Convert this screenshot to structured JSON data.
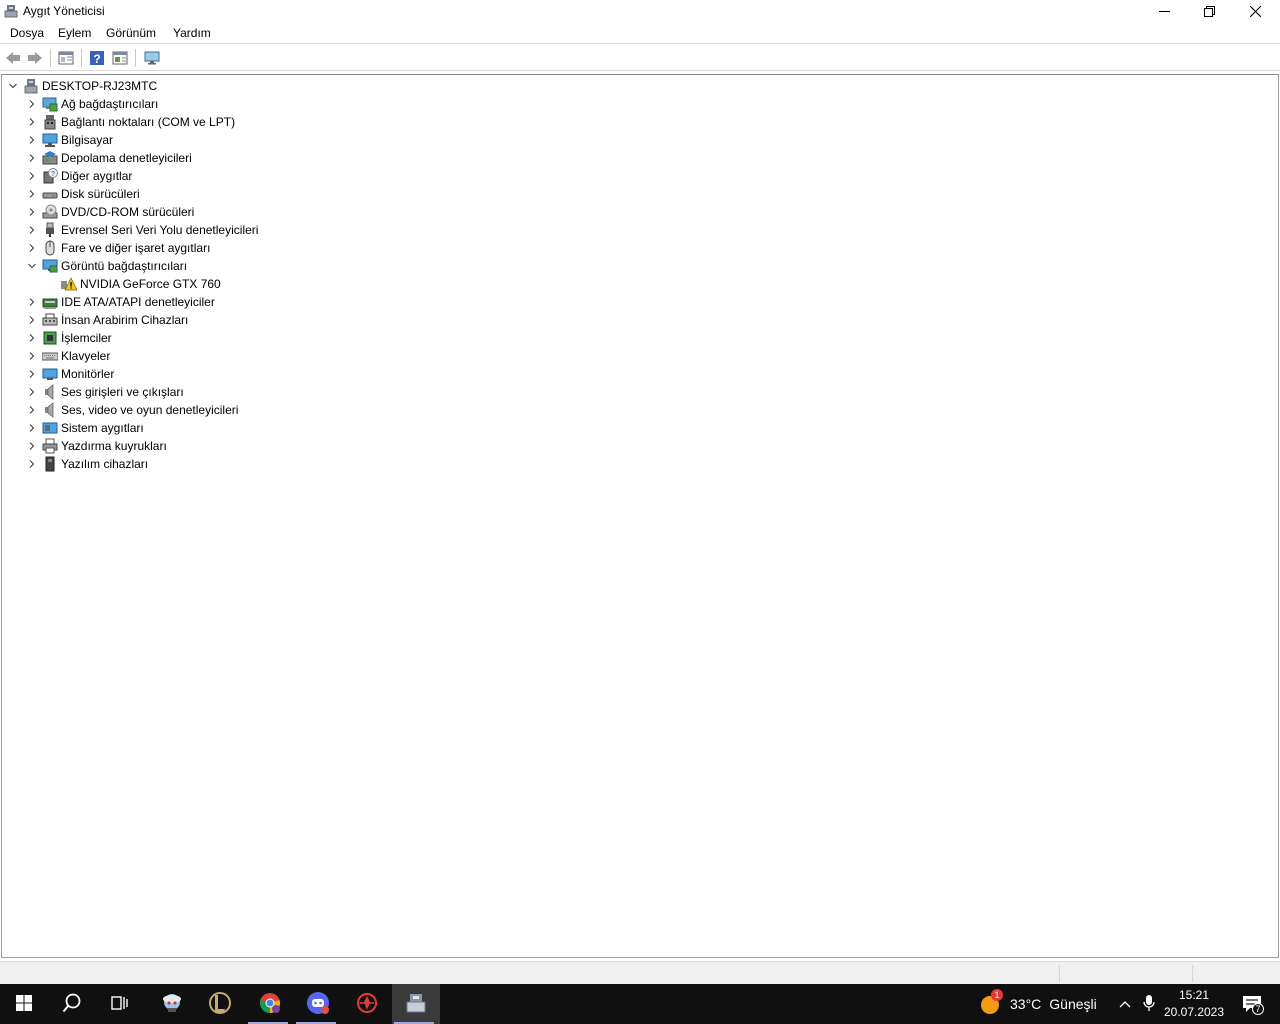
{
  "window": {
    "title": "Aygıt Yöneticisi"
  },
  "menu": [
    "Dosya",
    "Eylem",
    "Görünüm",
    "Yardım"
  ],
  "tree": {
    "root": "DESKTOP-RJ23MTC",
    "categories": [
      {
        "label": "Ağ bağdaştırıcıları",
        "icon": "network-adapter-icon",
        "expanded": false
      },
      {
        "label": "Bağlantı noktaları (COM ve LPT)",
        "icon": "port-icon",
        "expanded": false
      },
      {
        "label": "Bilgisayar",
        "icon": "computer-icon",
        "expanded": false
      },
      {
        "label": "Depolama denetleyicileri",
        "icon": "storage-controller-icon",
        "expanded": false
      },
      {
        "label": "Diğer aygıtlar",
        "icon": "other-devices-icon",
        "expanded": false
      },
      {
        "label": "Disk sürücüleri",
        "icon": "disk-drive-icon",
        "expanded": false
      },
      {
        "label": "DVD/CD-ROM sürücüleri",
        "icon": "dvd-drive-icon",
        "expanded": false
      },
      {
        "label": "Evrensel Seri Veri Yolu denetleyicileri",
        "icon": "usb-icon",
        "expanded": false
      },
      {
        "label": "Fare ve diğer işaret aygıtları",
        "icon": "mouse-icon",
        "expanded": false
      },
      {
        "label": "Görüntü bağdaştırıcıları",
        "icon": "display-adapter-icon",
        "expanded": true,
        "children": [
          {
            "label": "NVIDIA GeForce GTX 760",
            "icon": "warning-icon"
          }
        ]
      },
      {
        "label": "IDE ATA/ATAPI denetleyiciler",
        "icon": "ide-controller-icon",
        "expanded": false
      },
      {
        "label": "İnsan Arabirim Cihazları",
        "icon": "hid-icon",
        "expanded": false
      },
      {
        "label": "İşlemciler",
        "icon": "processor-icon",
        "expanded": false
      },
      {
        "label": "Klavyeler",
        "icon": "keyboard-icon",
        "expanded": false
      },
      {
        "label": "Monitörler",
        "icon": "monitor-icon",
        "expanded": false
      },
      {
        "label": "Ses girişleri ve çıkışları",
        "icon": "speaker-icon",
        "expanded": false
      },
      {
        "label": "Ses, video ve oyun denetleyicileri",
        "icon": "speaker-icon",
        "expanded": false
      },
      {
        "label": "Sistem aygıtları",
        "icon": "system-devices-icon",
        "expanded": false
      },
      {
        "label": "Yazdırma kuyrukları",
        "icon": "printer-icon",
        "expanded": false
      },
      {
        "label": "Yazılım cihazları",
        "icon": "software-device-icon",
        "expanded": false
      }
    ]
  },
  "taskbar": {
    "weather": {
      "temp": "33°C",
      "condition": "Güneşli",
      "badge": "1"
    },
    "clock": {
      "time": "15:21",
      "date": "20.07.2023"
    },
    "notifications": "7"
  }
}
